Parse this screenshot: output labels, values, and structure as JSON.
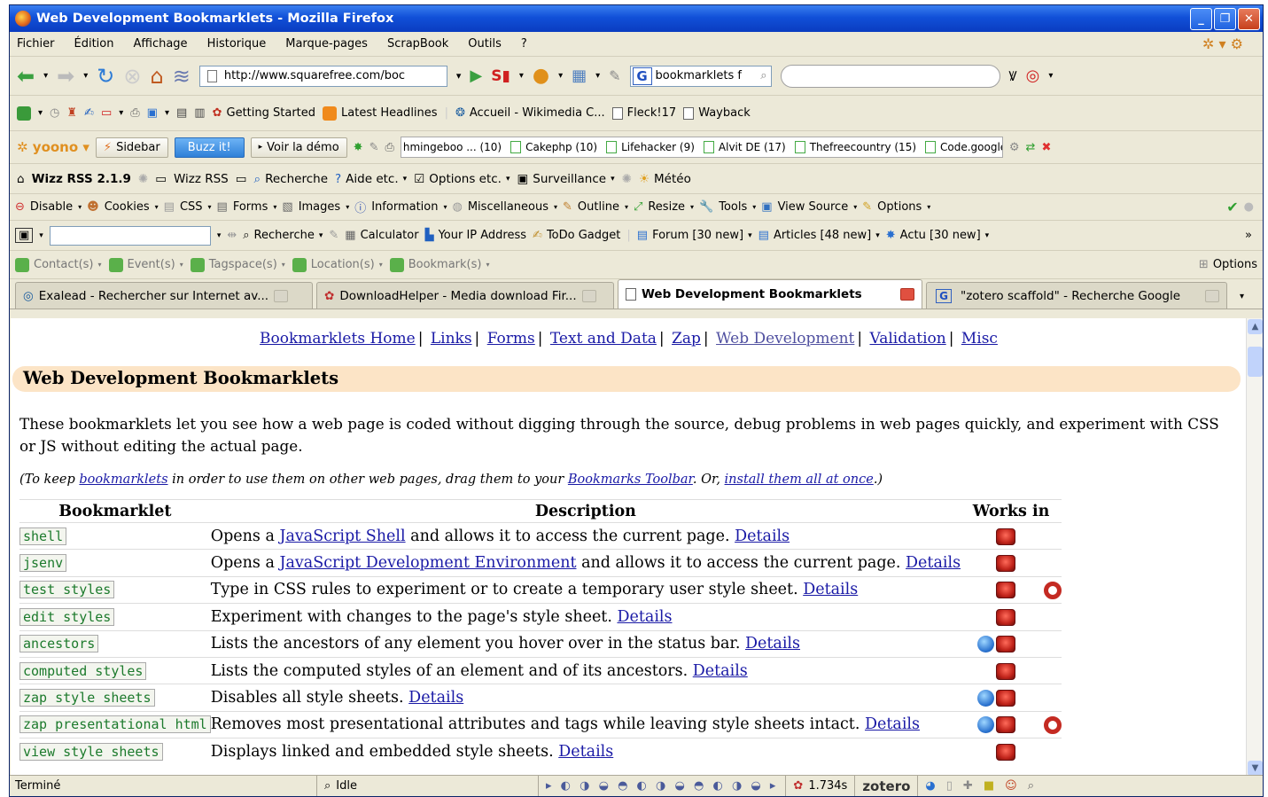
{
  "window": {
    "title": "Web Development Bookmarklets - Mozilla Firefox"
  },
  "menu": [
    "Fichier",
    "Édition",
    "Affichage",
    "Historique",
    "Marque-pages",
    "ScrapBook",
    "Outils",
    "?"
  ],
  "nav": {
    "url": "http://www.squarefree.com/boc",
    "search_value": "bookmarklets f"
  },
  "bookmarks_bar": [
    "Getting Started",
    "Latest Headlines",
    "Accueil - Wikimedia C...",
    "Fleck!17",
    "Wayback"
  ],
  "yoono_bar": {
    "sidebar": "Sidebar",
    "buzz": "Buzz it!",
    "demo": "Voir la démo",
    "tags": [
      "hmingeboo ... (10)",
      "Cakephp (10)",
      "Lifehacker (9)",
      "Alvit DE (17)",
      "Thefreecountry (15)",
      "Code.google ("
    ]
  },
  "wizz_bar": {
    "title": "Wizz RSS 2.1.9",
    "wizz": "Wizz RSS",
    "recherche": "Recherche",
    "aide": "Aide etc.",
    "options": "Options etc.",
    "surveillance": "Surveillance",
    "meteo": "Météo"
  },
  "webdev_bar": [
    "Disable",
    "Cookies",
    "CSS",
    "Forms",
    "Images",
    "Information",
    "Miscellaneous",
    "Outline",
    "Resize",
    "Tools",
    "View Source",
    "Options"
  ],
  "gadget_bar": {
    "recherche": "Recherche",
    "calculator": "Calculator",
    "ip": "Your IP Address",
    "todo": "ToDo Gadget",
    "forum": "Forum [30 new]",
    "articles": "Articles [48 new]",
    "actu": "Actu [30 new]",
    "more": "»"
  },
  "sixth_bar": {
    "items": [
      "Contact(s)",
      "Event(s)",
      "Tagspace(s)",
      "Location(s)",
      "Bookmark(s)"
    ],
    "options": "Options"
  },
  "tabs": [
    {
      "label": "Exalead - Rechercher sur Internet av...",
      "active": false
    },
    {
      "label": "DownloadHelper - Media download Fir...",
      "active": false
    },
    {
      "label": "Web Development Bookmarklets",
      "active": true
    },
    {
      "label": "\"zotero scaffold\" - Recherche Google",
      "active": false
    }
  ],
  "page": {
    "topnav": [
      "Bookmarklets Home",
      "Links",
      "Forms",
      "Text and Data",
      "Zap",
      "Web Development",
      "Validation",
      "Misc"
    ],
    "heading": "Web Development Bookmarklets",
    "intro": "These bookmarklets let you see how a web page is coded without digging through the source, debug problems in web pages quickly, and experiment with CSS or JS without editing the actual page.",
    "note": {
      "p1": "(To keep ",
      "l1": "bookmarklets",
      "p2": " in order to use them on other web pages, drag them to your ",
      "l2": "Bookmarks Toolbar",
      "p3": ". Or, ",
      "l3": "install them all at once",
      "p4": ".)"
    },
    "columns": [
      "Bookmarklet",
      "Description",
      "Works in"
    ],
    "rows": [
      {
        "name": "shell",
        "pre": "Opens a ",
        "link": "JavaScript Shell",
        "post": " and allows it to access the current page. ",
        "details": "Details",
        "browsers": [
          "firefox-icon"
        ]
      },
      {
        "name": "jsenv",
        "pre": "Opens a ",
        "link": "JavaScript Development Environment",
        "post": " and allows it to access the current page. ",
        "details": "Details",
        "browsers": [
          "firefox-icon"
        ]
      },
      {
        "name": "test styles",
        "pre": "Type in CSS rules to experiment or to create a temporary user style sheet. ",
        "link": "",
        "post": "",
        "details": "Details",
        "browsers": [
          "firefox-icon",
          "opera-icon"
        ]
      },
      {
        "name": "edit styles",
        "pre": "Experiment with changes to the page's style sheet. ",
        "link": "",
        "post": "",
        "details": "Details",
        "browsers": [
          "firefox-icon"
        ]
      },
      {
        "name": "ancestors",
        "pre": "Lists the ancestors of any element you hover over in the status bar. ",
        "link": "",
        "post": "",
        "details": "Details",
        "browsers": [
          "ie-icon",
          "firefox-icon"
        ]
      },
      {
        "name": "computed styles",
        "pre": "Lists the computed styles of an element and of its ancestors. ",
        "link": "",
        "post": "",
        "details": "Details",
        "browsers": [
          "firefox-icon"
        ]
      },
      {
        "name": "zap style sheets",
        "pre": "Disables all style sheets. ",
        "link": "",
        "post": "",
        "details": "Details",
        "browsers": [
          "ie-icon",
          "firefox-icon"
        ]
      },
      {
        "name": "zap presentational html",
        "pre": "Removes most presentational attributes and tags while leaving style sheets intact. ",
        "link": "",
        "post": "",
        "details": "Details",
        "browsers": [
          "ie-icon",
          "firefox-icon",
          "opera-icon"
        ]
      },
      {
        "name": "view style sheets",
        "pre": "Displays linked and embedded style sheets. ",
        "link": "",
        "post": "",
        "details": "Details",
        "browsers": [
          "firefox-icon"
        ]
      }
    ]
  },
  "status": {
    "text": "Terminé",
    "idle": "Idle",
    "time": "1.734s",
    "zotero": "zotero"
  }
}
